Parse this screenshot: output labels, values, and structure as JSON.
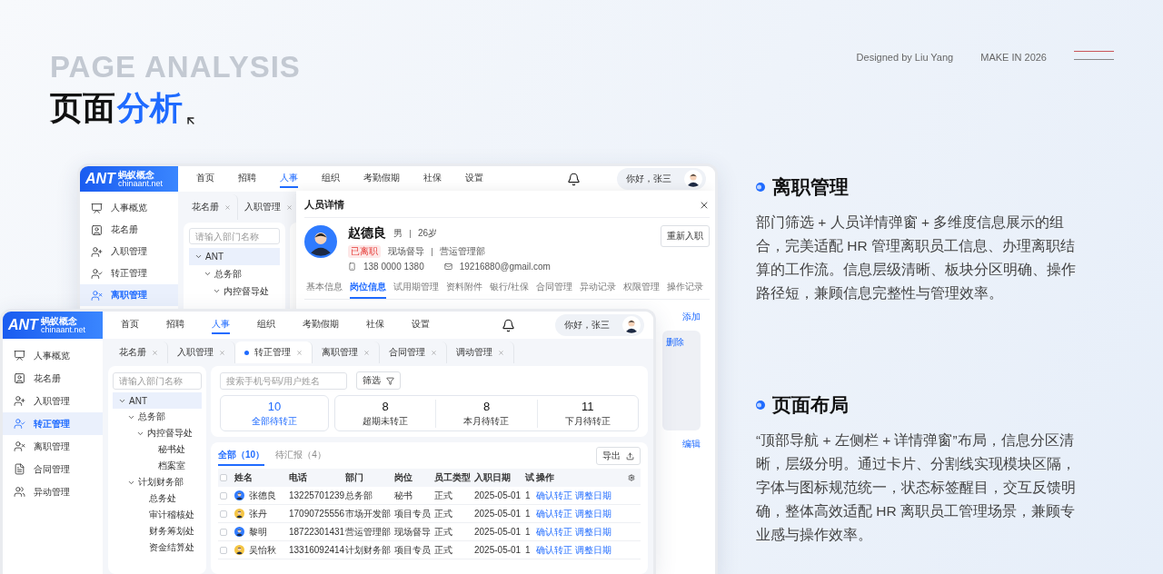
{
  "heading": {
    "backdrop": "PAGE ANALYSIS",
    "title": "页面",
    "title_accent": "分析"
  },
  "credits": {
    "designer": "Designed by Liu Yang",
    "edition": "MAKE IN 2026"
  },
  "back_window": {
    "logo": {
      "mark": "ANT",
      "name": "蚂蚁概念",
      "domain": "chinaant.net"
    },
    "nav": [
      {
        "label": "首页",
        "selected": false
      },
      {
        "label": "招聘",
        "selected": false
      },
      {
        "label": "人事",
        "selected": true
      },
      {
        "label": "组织",
        "selected": false
      },
      {
        "label": "考勤假期",
        "selected": false
      },
      {
        "label": "社保",
        "selected": false
      },
      {
        "label": "设置",
        "selected": false
      }
    ],
    "greeting": "你好，张三",
    "sidebar": [
      {
        "label": "人事概览",
        "selected": false
      },
      {
        "label": "花名册",
        "selected": false
      },
      {
        "label": "入职管理",
        "selected": false
      },
      {
        "label": "转正管理",
        "selected": false
      },
      {
        "label": "离职管理",
        "selected": true
      }
    ],
    "tabs": [
      {
        "label": "花名册",
        "selected": false
      },
      {
        "label": "入职管理",
        "selected": false
      }
    ],
    "tree": {
      "placeholder": "请输入部门名称",
      "nodes": [
        {
          "label": "ANT",
          "selected": true,
          "expanded": true,
          "children": [
            {
              "label": "总务部",
              "selected": false,
              "expanded": true,
              "children": [
                {
                  "label": "内控督导处",
                  "selected": false,
                  "expanded": true
                }
              ]
            }
          ]
        }
      ]
    },
    "modal": {
      "title": "人员详情",
      "person": {
        "name": "赵德良",
        "gender": "男",
        "age": "26岁",
        "status": "已离职",
        "position": "现场督导",
        "department": "营运管理部",
        "phone": "138 0000 1380",
        "email": "19216880@gmail.com"
      },
      "action": "重新入职",
      "tabs": [
        {
          "label": "基本信息",
          "selected": false
        },
        {
          "label": "岗位信息",
          "selected": true
        },
        {
          "label": "试用期管理",
          "selected": false
        },
        {
          "label": "资料附件",
          "selected": false
        },
        {
          "label": "银行/社保",
          "selected": false
        },
        {
          "label": "合同管理",
          "selected": false
        },
        {
          "label": "异动记录",
          "selected": false
        },
        {
          "label": "权限管理",
          "selected": false
        },
        {
          "label": "操作记录",
          "selected": false
        }
      ],
      "links": [
        "添加",
        "删除",
        "编辑"
      ]
    }
  },
  "front_window": {
    "logo": {
      "mark": "ANT",
      "name": "蚂蚁概念",
      "domain": "chinaant.net"
    },
    "nav": [
      {
        "label": "首页",
        "selected": false
      },
      {
        "label": "招聘",
        "selected": false
      },
      {
        "label": "人事",
        "selected": true
      },
      {
        "label": "组织",
        "selected": false
      },
      {
        "label": "考勤假期",
        "selected": false
      },
      {
        "label": "社保",
        "selected": false
      },
      {
        "label": "设置",
        "selected": false
      }
    ],
    "greeting": "你好，张三",
    "sidebar": [
      {
        "label": "人事概览",
        "selected": false
      },
      {
        "label": "花名册",
        "selected": false
      },
      {
        "label": "入职管理",
        "selected": false
      },
      {
        "label": "转正管理",
        "selected": true
      },
      {
        "label": "离职管理",
        "selected": false
      },
      {
        "label": "合同管理",
        "selected": false
      },
      {
        "label": "异动管理",
        "selected": false
      }
    ],
    "tabs": [
      {
        "label": "花名册",
        "selected": false
      },
      {
        "label": "入职管理",
        "selected": false
      },
      {
        "label": "转正管理",
        "selected": true
      },
      {
        "label": "离职管理",
        "selected": false
      },
      {
        "label": "合同管理",
        "selected": false
      },
      {
        "label": "调动管理",
        "selected": false
      }
    ],
    "tree": {
      "placeholder": "请输入部门名称",
      "nodes": [
        {
          "label": "ANT",
          "selected": true,
          "expanded": true,
          "children": [
            {
              "label": "总务部",
              "selected": false,
              "expanded": true,
              "children": [
                {
                  "label": "内控督导处",
                  "selected": false,
                  "expanded": true,
                  "children": [
                    {
                      "label": "秘书处",
                      "selected": false
                    },
                    {
                      "label": "档案室",
                      "selected": false
                    }
                  ]
                }
              ]
            },
            {
              "label": "计划财务部",
              "selected": false,
              "expanded": true,
              "children": [
                {
                  "label": "总务处",
                  "selected": false
                },
                {
                  "label": "审计稽核处",
                  "selected": false
                },
                {
                  "label": "财务筹划处",
                  "selected": false
                },
                {
                  "label": "资金结算处",
                  "selected": false
                }
              ]
            }
          ]
        }
      ]
    },
    "search": {
      "placeholder": "搜索手机号码/用户姓名"
    },
    "filter": "筛选",
    "stats": [
      {
        "value": "10",
        "label": "全部待转正",
        "selected": true
      },
      {
        "value": "8",
        "label": "超期未转正",
        "selected": false
      },
      {
        "value": "8",
        "label": "本月待转正",
        "selected": false
      },
      {
        "value": "11",
        "label": "下月待转正",
        "selected": false
      }
    ],
    "list_tabs": [
      {
        "label": "全部（10）",
        "selected": true
      },
      {
        "label": "待汇报（4）",
        "selected": false
      }
    ],
    "export": "导出",
    "table": {
      "all_checked": false,
      "columns": [
        "姓名",
        "电话",
        "部门",
        "岗位",
        "员工类型",
        "入职日期",
        "试",
        "操作"
      ],
      "rows": [
        {
          "checked": false,
          "color": "#2f7bff",
          "name": "张德良",
          "phone": "13225701239",
          "department": "总务部",
          "position": "秘书",
          "type": "正式",
          "date": "2025-05-01",
          "probation": "1",
          "actions": [
            "确认转正",
            "调整日期"
          ]
        },
        {
          "checked": false,
          "color": "#f5c542",
          "name": "张丹",
          "phone": "17090725556",
          "department": "市场开发部",
          "position": "项目专员",
          "type": "正式",
          "date": "2025-05-01",
          "probation": "1",
          "actions": [
            "确认转正",
            "调整日期"
          ]
        },
        {
          "checked": false,
          "color": "#2f7bff",
          "name": "黎明",
          "phone": "18722301431",
          "department": "营运管理部",
          "position": "现场督导",
          "type": "正式",
          "date": "2025-05-01",
          "probation": "1",
          "actions": [
            "确认转正",
            "调整日期"
          ]
        },
        {
          "checked": false,
          "color": "#f5c542",
          "name": "吴怡秋",
          "phone": "13316092414",
          "department": "计划财务部",
          "position": "项目专员",
          "type": "正式",
          "date": "2025-05-01",
          "probation": "1",
          "actions": [
            "确认转正",
            "调整日期"
          ]
        }
      ]
    }
  },
  "sections": [
    {
      "title": "离职管理",
      "body": "部门筛选 + 人员详情弹窗 + 多维度信息展示的组合，完美适配 HR 管理离职员工信息、办理离职结算的工作流。信息层级清晰、板块分区明确、操作路径短，兼顾信息完整性与管理效率。"
    },
    {
      "title": "页面布局",
      "body": "“顶部导航 + 左侧栏 + 详情弹窗”布局，信息分区清晰，层级分明。通过卡片、分割线实现模块区隔，字体与图标规范统一，状态标签醒目，交互反馈明确，整体高效适配 HR 离职员工管理场景，兼顾专业感与操作效率。"
    }
  ]
}
